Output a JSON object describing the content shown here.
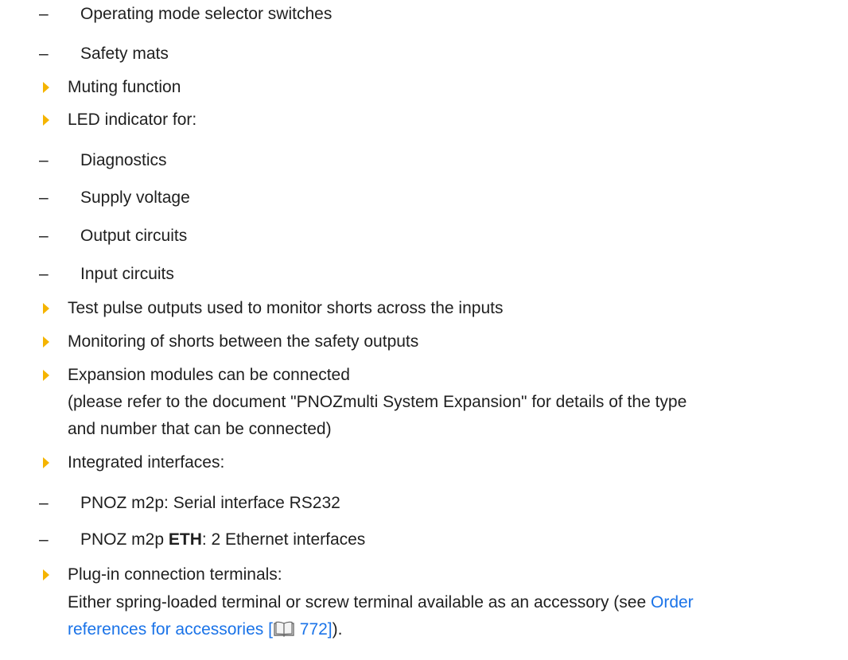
{
  "items": {
    "operating_mode": "Operating mode selector switches",
    "safety_mats": "Safety mats",
    "muting": "Muting function",
    "led": "LED indicator for:",
    "diagnostics": "Diagnostics",
    "supply_voltage": "Supply voltage",
    "output_circuits": "Output circuits",
    "input_circuits": "Input circuits",
    "test_pulse": "Test pulse outputs used to monitor shorts across the inputs",
    "monitoring_shorts": "Monitoring of shorts between the safety outputs",
    "expansion": "Expansion modules can be connected",
    "expansion_note_1": "(please refer to the document \"PNOZmulti System Expansion\" for details of the type",
    "expansion_note_2": "and number that can be connected)",
    "integrated": "Integrated interfaces:",
    "m2p_serial": "PNOZ m2p: Serial interface RS232",
    "m2p_eth_prefix": "PNOZ m2p ",
    "m2p_eth_bold": "ETH",
    "m2p_eth_suffix": ": 2 Ethernet interfaces",
    "plugin": "Plug-in connection terminals:",
    "plugin_note_prefix": "Either spring-loaded terminal or screw terminal available as an accessory (see ",
    "link_line1": "Order",
    "link_line2_text": "references for accessories [",
    "link_page": " 772]",
    "plugin_note_end": ")."
  },
  "dash": "–",
  "colors": {
    "bullet": "#f5b400",
    "link": "#1a73e8",
    "text": "#1f1f1f"
  },
  "icons": {
    "bullet": "orange-triangle-bullet-icon",
    "reference": "book-icon"
  }
}
